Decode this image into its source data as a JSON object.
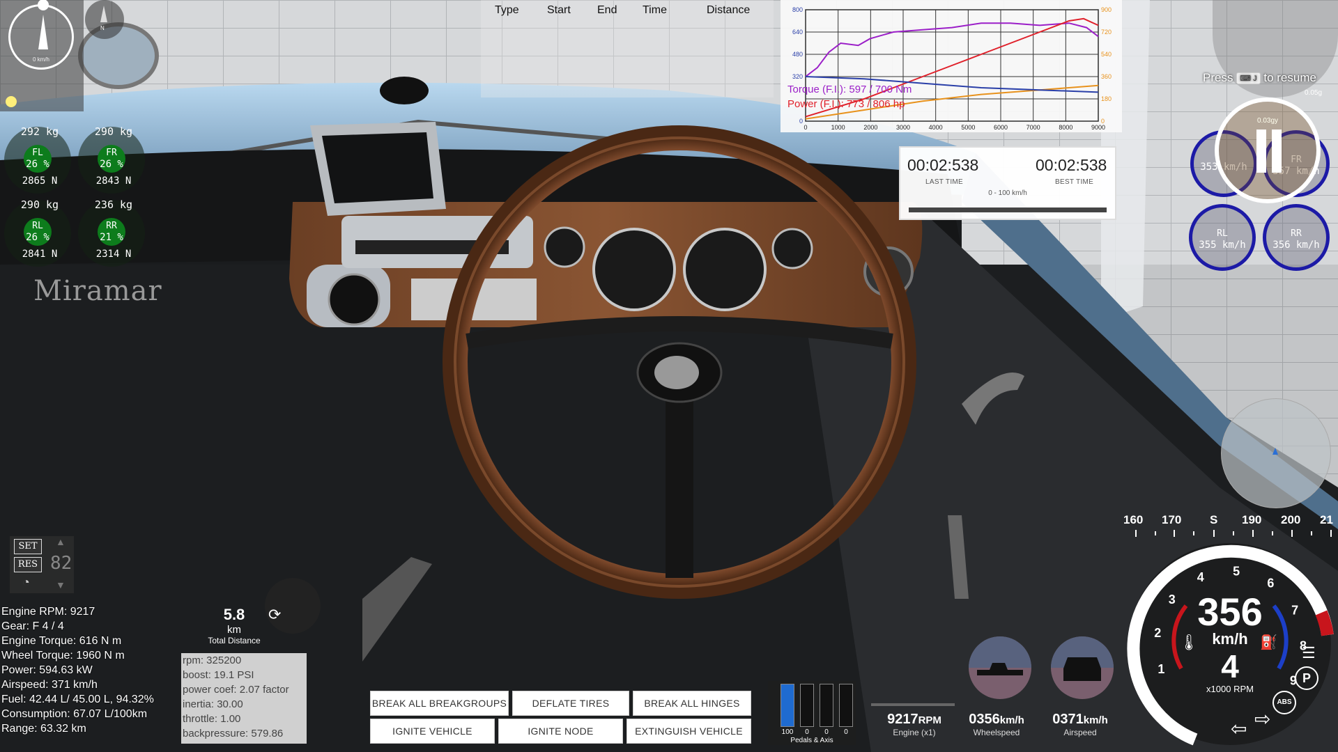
{
  "compass": {
    "speed": "0 km/h",
    "small_label": "N"
  },
  "tires": [
    {
      "id": "FL",
      "kg": "292 kg",
      "pct": "26 %",
      "force": "2865 N"
    },
    {
      "id": "FR",
      "kg": "290 kg",
      "pct": "26 %",
      "force": "2843 N"
    },
    {
      "id": "RL",
      "kg": "290 kg",
      "pct": "26 %",
      "force": "2841 N"
    },
    {
      "id": "RR",
      "kg": "236 kg",
      "pct": "21 %",
      "force": "2314 N"
    }
  ],
  "brand": "Miramar",
  "race_table": {
    "headers": [
      "Type",
      "Start",
      "End",
      "Time",
      "Distance"
    ]
  },
  "torque_graph": {
    "torque_line": "Torque (F.I.): 597 / 700 Nm",
    "power_line": "Power (F.I.): 773 / 806 hp",
    "left_ticks": [
      "800",
      "640",
      "480",
      "320",
      "0"
    ],
    "right_ticks": [
      "900",
      "720",
      "540",
      "360",
      "180",
      "0"
    ],
    "x_ticks": [
      "0",
      "1000",
      "2000",
      "3000",
      "4000",
      "5000",
      "6000",
      "7000",
      "8000",
      "9000"
    ],
    "colors": {
      "torque": "#9b1fc8",
      "power": "#e0202a",
      "orange": "#e8921c",
      "blue": "#2a3fa8"
    }
  },
  "timer": {
    "last_time": "00:02:538",
    "last_label": "LAST TIME",
    "best_time": "00:02:538",
    "best_label": "BEST TIME",
    "range": "0 - 100 km/h"
  },
  "resume": {
    "press": "Press",
    "key": "J",
    "suffix": "to resume",
    "g_small": "0.05g",
    "g_mid": "0.03gy"
  },
  "wheel_speeds": [
    {
      "id": "FL",
      "speed": "353 km/h"
    },
    {
      "id": "FR",
      "speed": "357 km/h"
    },
    {
      "id": "RL",
      "speed": "355 km/h"
    },
    {
      "id": "RR",
      "speed": "356 km/h"
    }
  ],
  "cruise": {
    "set": "SET",
    "res": "RES",
    "value": "82"
  },
  "telemetry": [
    "Engine RPM: 9217",
    "Gear: F 4 / 4",
    "Engine Torque: 616 N m",
    "Wheel Torque: 1960 N m",
    "Power: 594.63 kW",
    "Airspeed: 371 km/h",
    "Fuel: 42.44 L/ 45.00 L, 94.32%",
    "Consumption: 67.07 L/100km",
    "Range: 63.32 km"
  ],
  "distance": {
    "value": "5.8",
    "unit": "km",
    "label": "Total Distance"
  },
  "engine_info": [
    "rpm: 325200",
    "boost: 19.1 PSI",
    "power coef: 2.07 factor",
    "inertia: 30.00",
    "throttle: 1.00",
    "backpressure: 579.86"
  ],
  "buttons": {
    "break_groups": "BREAK ALL BREAKGROUPS",
    "deflate": "DEFLATE TIRES",
    "break_hinges": "BREAK ALL HINGES",
    "ignite_vehicle": "IGNITE VEHICLE",
    "ignite_node": "IGNITE NODE",
    "extinguish": "EXTINGUISH VEHICLE"
  },
  "pedals": {
    "values": [
      "100",
      "0",
      "0",
      "0"
    ],
    "fills": [
      1.0,
      0,
      0,
      0
    ],
    "label": "Pedals & Axis"
  },
  "readouts": {
    "rpm": {
      "value": "9217",
      "unit": "RPM",
      "label": "Engine (x1)"
    },
    "wheelspeed": {
      "value": "0356",
      "unit": "km/h",
      "label": "Wheelspeed"
    },
    "airspeed": {
      "value": "0371",
      "unit": "km/h",
      "label": "Airspeed"
    }
  },
  "heading_strip": [
    "160",
    "170",
    "S",
    "190",
    "200",
    "21"
  ],
  "speedo": {
    "speed": "356",
    "unit": "km/h",
    "gear": "4",
    "rpm_label": "x1000 RPM",
    "ticks": [
      "1",
      "2",
      "3",
      "4",
      "5",
      "6",
      "7",
      "8",
      "9"
    ],
    "abs": "ABS",
    "park": "P"
  }
}
